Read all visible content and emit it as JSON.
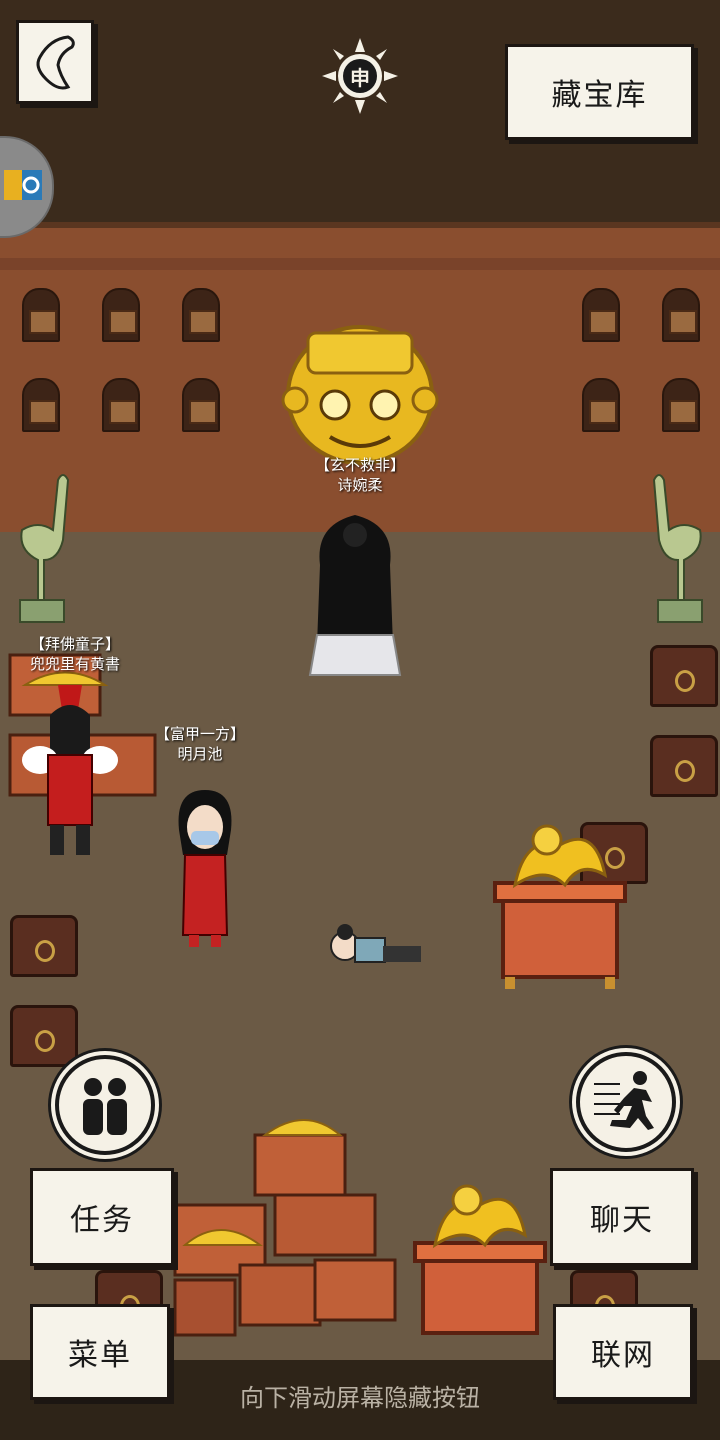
{
  "header": {
    "treasury_label": "藏宝库",
    "time_glyph": "申"
  },
  "characters": [
    {
      "title": "【玄不救非】",
      "name": "诗婉柔"
    },
    {
      "title": "【拜佛童子】",
      "name": "兜兜里有黄書"
    },
    {
      "title": "【富甲一方】",
      "name": "明月池"
    }
  ],
  "buttons": {
    "task": "任务",
    "menu": "菜单",
    "chat": "聊天",
    "network": "联网"
  },
  "hint": "向下滑动屏幕隐藏按钮",
  "icons": {
    "back": "back-arrow-icon",
    "sun": "sun-time-icon",
    "players": "players-icon",
    "run": "run-icon",
    "app": "app-badge-icon"
  },
  "colors": {
    "button_bg": "#f6f3ea",
    "border": "#1c1612",
    "wall": "#8a4e2f",
    "floor": "#6b5a45",
    "gold": "#e8b820"
  }
}
